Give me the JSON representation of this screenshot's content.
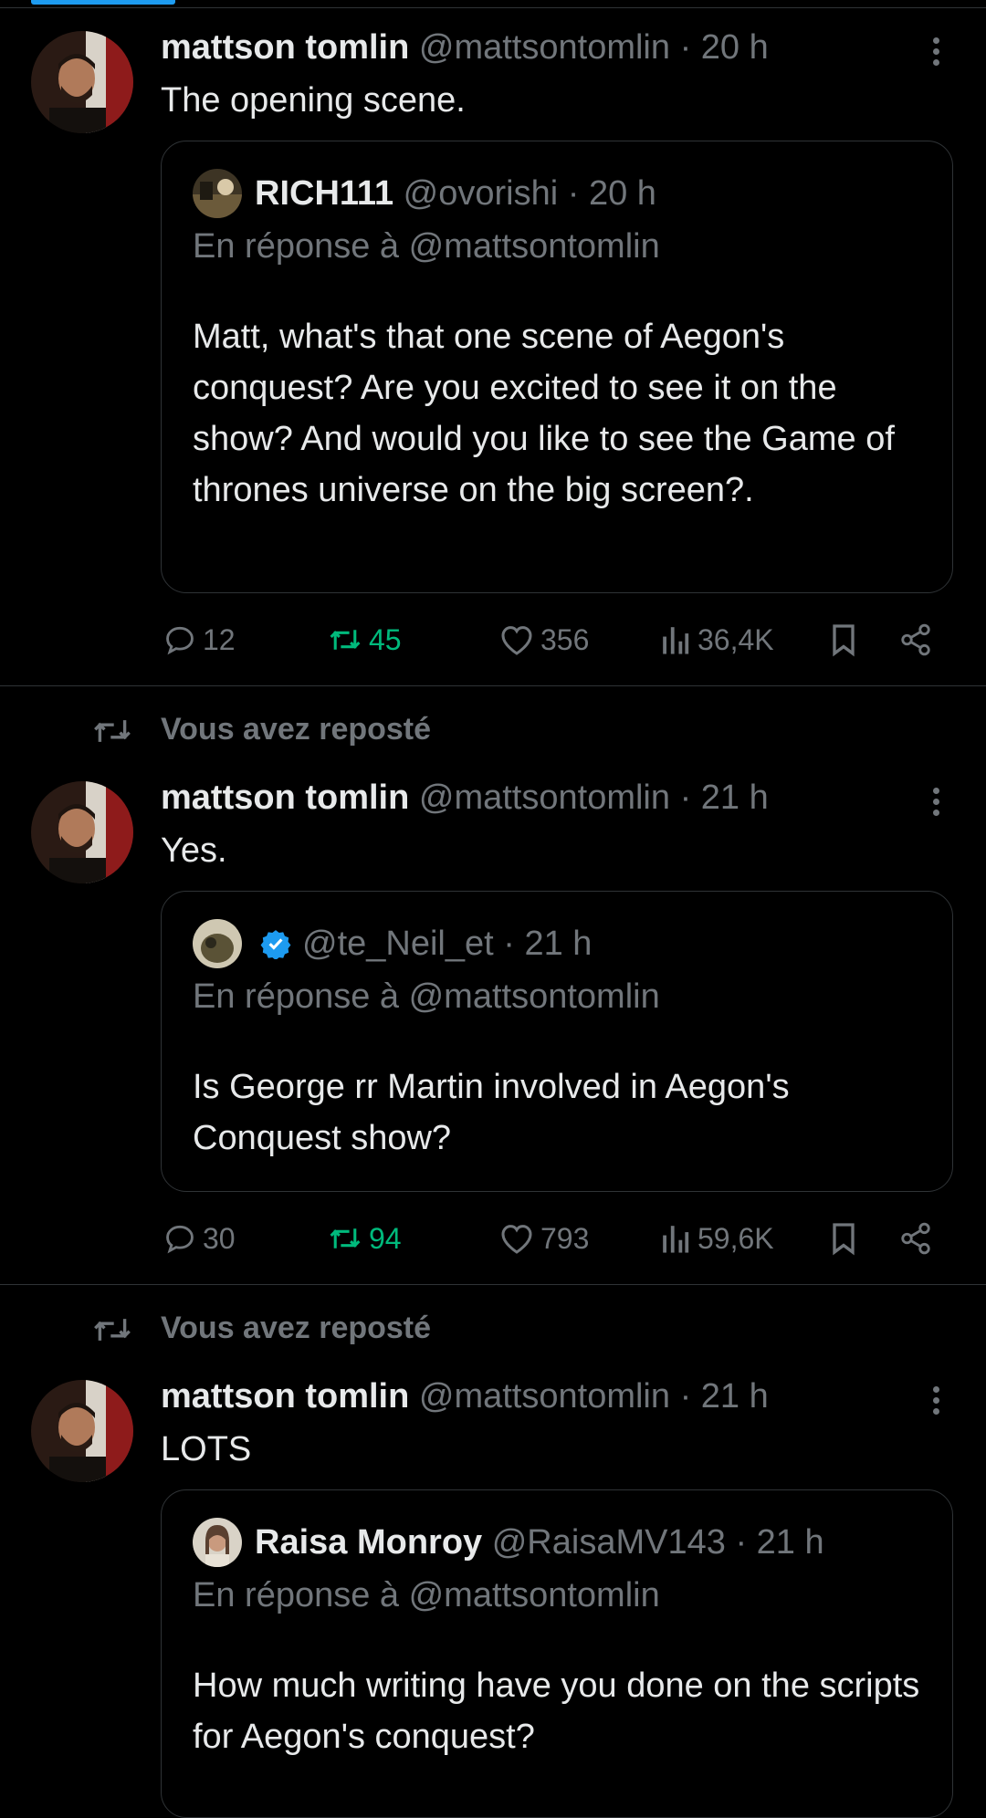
{
  "colors": {
    "background": "#000000",
    "text": "#e7e9ea",
    "muted": "#71767b",
    "accent": "#1d9bf0",
    "repost_green": "#00ba7c",
    "border": "#2f3336"
  },
  "posts": [
    {
      "repost_label": "",
      "author": {
        "name": "mattson tomlin",
        "handle": "@mattsontomlin",
        "sep": "·",
        "time": "20 h"
      },
      "text": "The opening scene.",
      "quote": {
        "name": "RICH111",
        "handle": "@ovorishi",
        "sep": "·",
        "time": "20 h",
        "verified": false,
        "reply": "En réponse à @mattsontomlin",
        "text": "Matt, what's that one scene of Aegon's conquest? Are you excited to see it on the show? And would you like to see the Game of thrones universe on the big screen?."
      },
      "stats": {
        "replies": "12",
        "reposts": "45",
        "likes": "356",
        "views": "36,4K"
      }
    },
    {
      "repost_label": "Vous avez reposté",
      "author": {
        "name": "mattson tomlin",
        "handle": "@mattsontomlin",
        "sep": "·",
        "time": "21 h"
      },
      "text": "Yes.",
      "quote": {
        "name": "",
        "handle": "@te_Neil_et",
        "sep": "·",
        "time": "21 h",
        "verified": true,
        "reply": "En réponse à @mattsontomlin",
        "text": "Is George rr Martin involved in Aegon's Conquest show?"
      },
      "stats": {
        "replies": "30",
        "reposts": "94",
        "likes": "793",
        "views": "59,6K"
      }
    },
    {
      "repost_label": "Vous avez reposté",
      "author": {
        "name": "mattson tomlin",
        "handle": "@mattsontomlin",
        "sep": "·",
        "time": "21 h"
      },
      "text": "LOTS",
      "quote": {
        "name": "Raisa Monroy",
        "handle": "@RaisaMV143",
        "sep": "·",
        "time": "21 h",
        "verified": false,
        "reply": "En réponse à @mattsontomlin",
        "text": "How much writing have you done on the scripts for Aegon's conquest?"
      }
    }
  ]
}
